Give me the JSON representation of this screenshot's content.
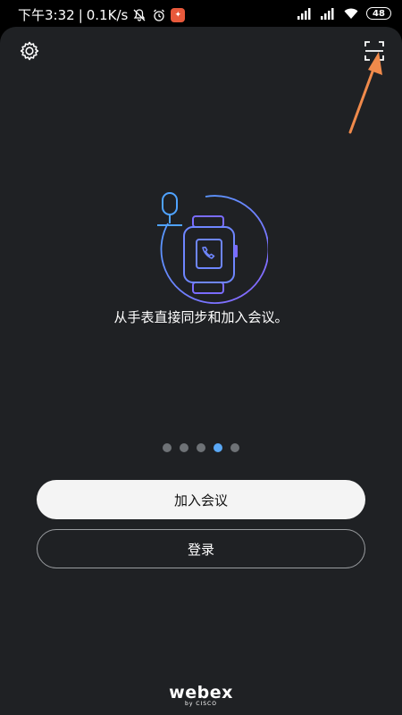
{
  "status_bar": {
    "time": "下午3:32",
    "separator": "|",
    "network_speed": "0.1K/s",
    "battery": "48"
  },
  "top_bar": {
    "settings_icon": "gear-icon",
    "scan_icon": "qr-scan-icon"
  },
  "onboarding": {
    "caption": "从手表直接同步和加入会议。",
    "page_count": 5,
    "active_page": 4
  },
  "actions": {
    "join_label": "加入会议",
    "login_label": "登录"
  },
  "brand": {
    "name": "webex",
    "by": "by CISCO"
  },
  "colors": {
    "background": "#1f2124",
    "accent_dot": "#5aa8f5",
    "illustration_gradient_start": "#4fa3ff",
    "illustration_gradient_end": "#8a62ff",
    "annotation_arrow": "#f08a4b"
  }
}
